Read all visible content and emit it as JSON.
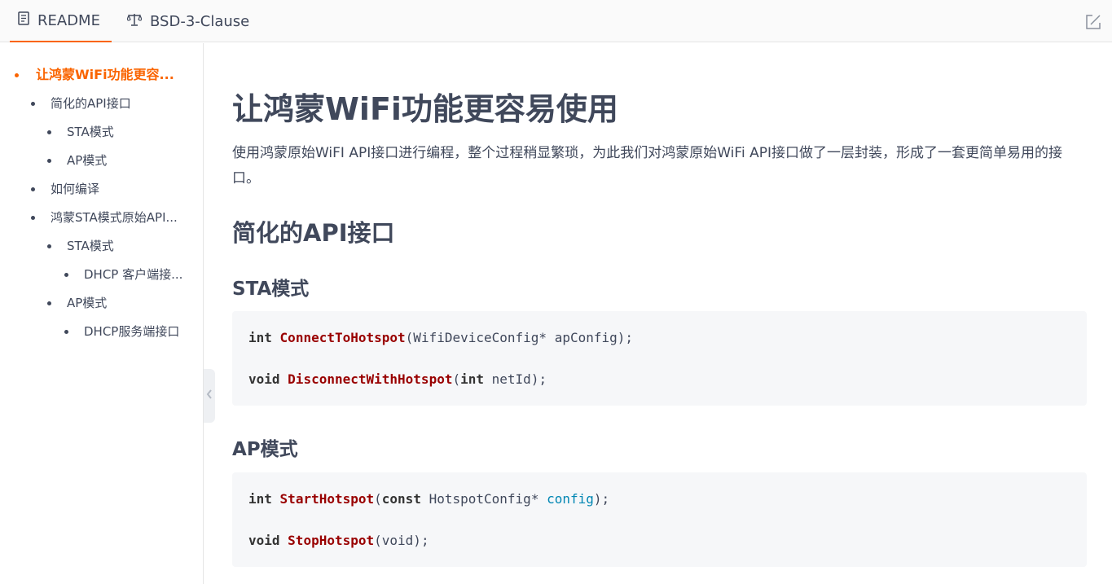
{
  "tabs": [
    {
      "label": "README",
      "icon": "document-icon"
    },
    {
      "label": "BSD-3-Clause",
      "icon": "scale-icon"
    }
  ],
  "toc": [
    {
      "label": "让鸿蒙WiFi功能更容...",
      "level": 0,
      "active": true
    },
    {
      "label": "简化的API接口",
      "level": 1
    },
    {
      "label": "STA模式",
      "level": 2
    },
    {
      "label": "AP模式",
      "level": 2
    },
    {
      "label": "如何编译",
      "level": 1
    },
    {
      "label": "鸿蒙STA模式原始API...",
      "level": 1
    },
    {
      "label": "STA模式",
      "level": 2
    },
    {
      "label": "DHCP 客户端接...",
      "level": 3
    },
    {
      "label": "AP模式",
      "level": 2
    },
    {
      "label": "DHCP服务端接口",
      "level": 3
    }
  ],
  "article": {
    "title": "让鸿蒙WiFi功能更容易使用",
    "description": "使用鸿蒙原始WiFI API接口进行编程，整个过程稍显繁琐，为此我们对鸿蒙原始WiFi API接口做了一层封装，形成了一套更简单易用的接口。",
    "section_title": "简化的API接口",
    "sta_heading": "STA模式",
    "ap_heading": "AP模式",
    "sta_code": {
      "line1": {
        "type": "int",
        "fn": "ConnectToHotspot",
        "args": "(WifiDeviceConfig* apConfig);"
      },
      "line2": {
        "type": "void",
        "fn": "DisconnectWithHotspot",
        "open": "(",
        "argtype": "int",
        "args": " netId);"
      }
    },
    "ap_code": {
      "line1": {
        "type": "int",
        "fn": "StartHotspot",
        "open": "(",
        "argtype": "const",
        "args1": " HotspotConfig* ",
        "param": "config",
        "close": ");"
      },
      "line2": {
        "type": "void",
        "fn": "StopHotspot",
        "args": "(void);"
      }
    }
  },
  "colors": {
    "accent": "#fa6400",
    "text": "#40485b",
    "code_bg": "#f6f7f9",
    "code_function": "#990000",
    "code_param": "#0086b3"
  }
}
